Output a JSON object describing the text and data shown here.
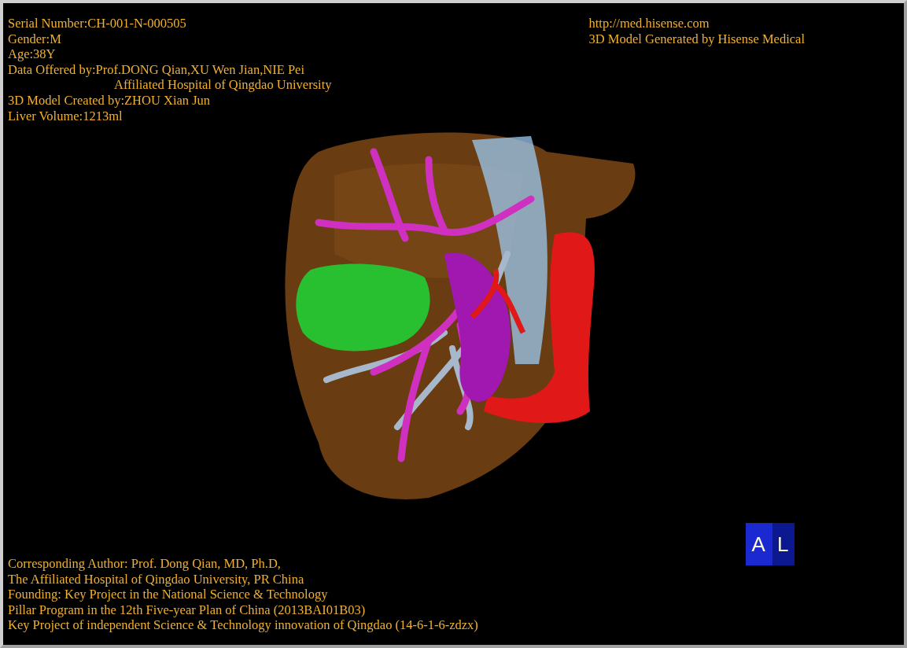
{
  "case_info": [
    {
      "text": "Serial Number:CH-001-N-000505",
      "indented": false
    },
    {
      "text": "Gender:M",
      "indented": false
    },
    {
      "text": "Age:38Y",
      "indented": false
    },
    {
      "text": "Data Offered by:Prof.DONG Qian,XU Wen Jian,NIE Pei",
      "indented": false
    },
    {
      "text": "Affiliated Hospital of Qingdao University",
      "indented": true
    },
    {
      "text": "3D Model Created by:ZHOU Xian Jun",
      "indented": false
    },
    {
      "text": "Liver Volume:1213ml",
      "indented": false
    }
  ],
  "generator_info": [
    "http://med.hisense.com",
    "3D Model Generated by Hisense Medical"
  ],
  "credits": [
    "Corresponding Author: Prof. Dong Qian, MD, Ph.D,",
    "The Affiliated Hospital of Qingdao University, PR China",
    "Founding: Key Project in the National Science & Technology",
    "Pillar Program in the 12th Five-year Plan of China (2013BAI01B03)",
    "Key Project of independent Science & Technology innovation of Qingdao (14-6-1-6-zdzx)"
  ],
  "orientation_cube": {
    "front": "A",
    "side": "L"
  }
}
